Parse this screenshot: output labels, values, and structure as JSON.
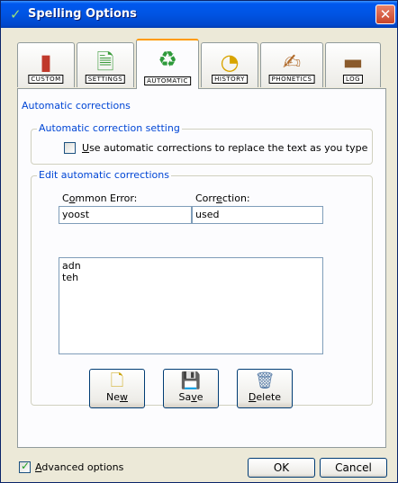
{
  "window": {
    "title": "Spelling Options",
    "close_glyph": "✕",
    "title_icon": "checkmark-icon"
  },
  "tabs": [
    {
      "label": "CUSTOM",
      "icon": "book-icon",
      "active": false
    },
    {
      "label": "SETTINGS",
      "icon": "document-check-icon",
      "active": false
    },
    {
      "label": "AUTOMATIC",
      "icon": "recycle-arrows-icon",
      "active": true
    },
    {
      "label": "HISTORY",
      "icon": "clock-icon",
      "active": false
    },
    {
      "label": "PHONETICS",
      "icon": "hand-pen-icon",
      "active": false
    },
    {
      "label": "LOG",
      "icon": "log-icon",
      "active": false
    }
  ],
  "panel": {
    "group_title": "Automatic corrections",
    "setting_group_title": "Automatic correction setting",
    "use_auto_pre": "",
    "use_auto_mnemonic": "U",
    "use_auto_rest": "se automatic corrections to replace the text as you type",
    "use_auto_checked": false,
    "edit_group_title": "Edit automatic corrections",
    "common_error_label_pre": "C",
    "common_error_label_mn": "o",
    "common_error_label_rest": "mmon Error:",
    "correction_label_pre": "Corr",
    "correction_label_mn": "e",
    "correction_label_rest": "ction:",
    "common_error_value": "yoost",
    "correction_value": "used",
    "list_items": [
      "adn",
      "teh"
    ],
    "new_label_pre": "Ne",
    "new_label_mn": "w",
    "save_label_pre": "Sa",
    "save_label_mn": "v",
    "save_label_rest": "e",
    "delete_label_mn": "D",
    "delete_label_rest": "elete"
  },
  "footer": {
    "advanced_mn": "A",
    "advanced_rest": "dvanced options",
    "advanced_checked": true,
    "ok_label": "OK",
    "cancel_label": "Cancel"
  }
}
